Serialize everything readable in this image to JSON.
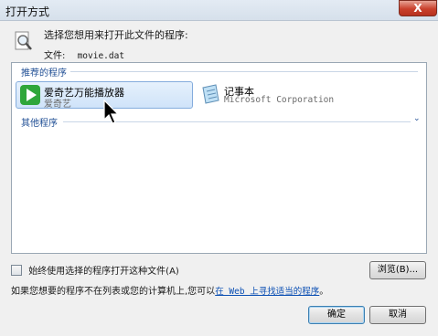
{
  "window": {
    "title": "打开方式",
    "close_label": "X"
  },
  "header": {
    "prompt": "选择您想用来打开此文件的程序:",
    "file_label": "文件:",
    "file_name": "movie.dat"
  },
  "list": {
    "recommended_label": "推荐的程序",
    "other_label": "其他程序",
    "expand_glyph": "⌄",
    "programs": [
      {
        "name": "爱奇艺万能播放器",
        "publisher": "爱奇艺",
        "icon": "iqiyi-player-icon",
        "selected": true
      },
      {
        "name": "记事本",
        "publisher": "Microsoft Corporation",
        "icon": "notepad-icon",
        "selected": false
      }
    ]
  },
  "options": {
    "always_use_label": "始终使用选择的程序打开这种文件(A)",
    "always_use_checked": false,
    "hint_text": "如果您想要的程序不在列表或您的计算机上,您可以",
    "hint_link": "在 Web 上寻找适当的程序",
    "hint_suffix": "。"
  },
  "buttons": {
    "browse": "浏览(B)...",
    "ok": "确定",
    "cancel": "取消"
  },
  "colors": {
    "accent": "#1f4e94",
    "selection": "#cfe3f9",
    "iqiyi_green": "#2fa63a"
  }
}
